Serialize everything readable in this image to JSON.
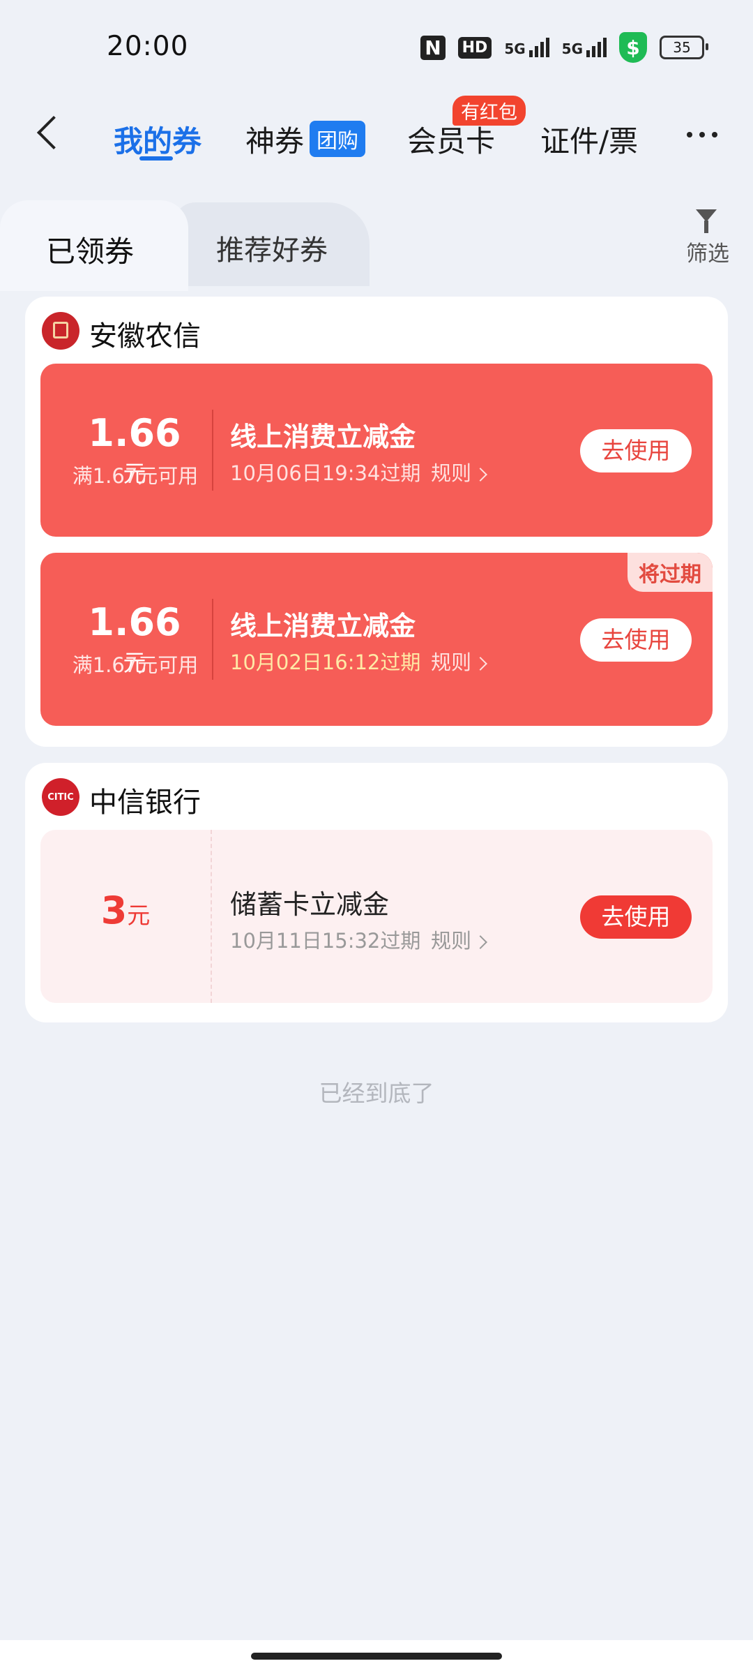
{
  "status_bar": {
    "time": "20:00",
    "hd_label": "HD",
    "signal1_label": "5G",
    "signal2_label": "5G",
    "shield_symbol": "$",
    "battery_level": "35",
    "icons": [
      "nfc-icon",
      "hd-icon",
      "signal-5g-icon",
      "signal-5g-icon",
      "security-shield-icon",
      "battery-icon"
    ]
  },
  "nav": {
    "tabs": [
      {
        "label": "我的券"
      },
      {
        "label": "神券"
      },
      {
        "label": "会员卡"
      },
      {
        "label": "证件/票"
      }
    ],
    "group_badge": "团购",
    "redpacket_badge": "有红包",
    "accent_color": "#1b70e8"
  },
  "subtabs": {
    "received": "已领券",
    "recommend": "推荐好券",
    "filter_label": "筛选"
  },
  "groups": [
    {
      "bank": "安徽农信",
      "coupons": [
        {
          "amount": "1.66",
          "unit": "元",
          "condition": "满1.67元可用",
          "title": "线上消费立减金",
          "expire": "10月06日19:34过期",
          "rule": "规则",
          "button": "去使用"
        },
        {
          "amount": "1.66",
          "unit": "元",
          "condition": "满1.67元可用",
          "title": "线上消费立减金",
          "expire": "10月02日16:12过期",
          "rule": "规则",
          "button": "去使用",
          "tag": "将过期"
        }
      ]
    },
    {
      "bank": "中信银行",
      "logo_text": "CITIC",
      "coupons": [
        {
          "amount": "3",
          "unit": "元",
          "title": "储蓄卡立减金",
          "expire": "10月11日15:32过期",
          "rule": "规则",
          "button": "去使用"
        }
      ]
    }
  ],
  "footer": {
    "end_text": "已经到底了"
  },
  "colors": {
    "coupon_red": "#f65d57",
    "coupon_pink": "#fdf0f1",
    "button_red": "#f03a35",
    "background": "#eef1f7"
  }
}
